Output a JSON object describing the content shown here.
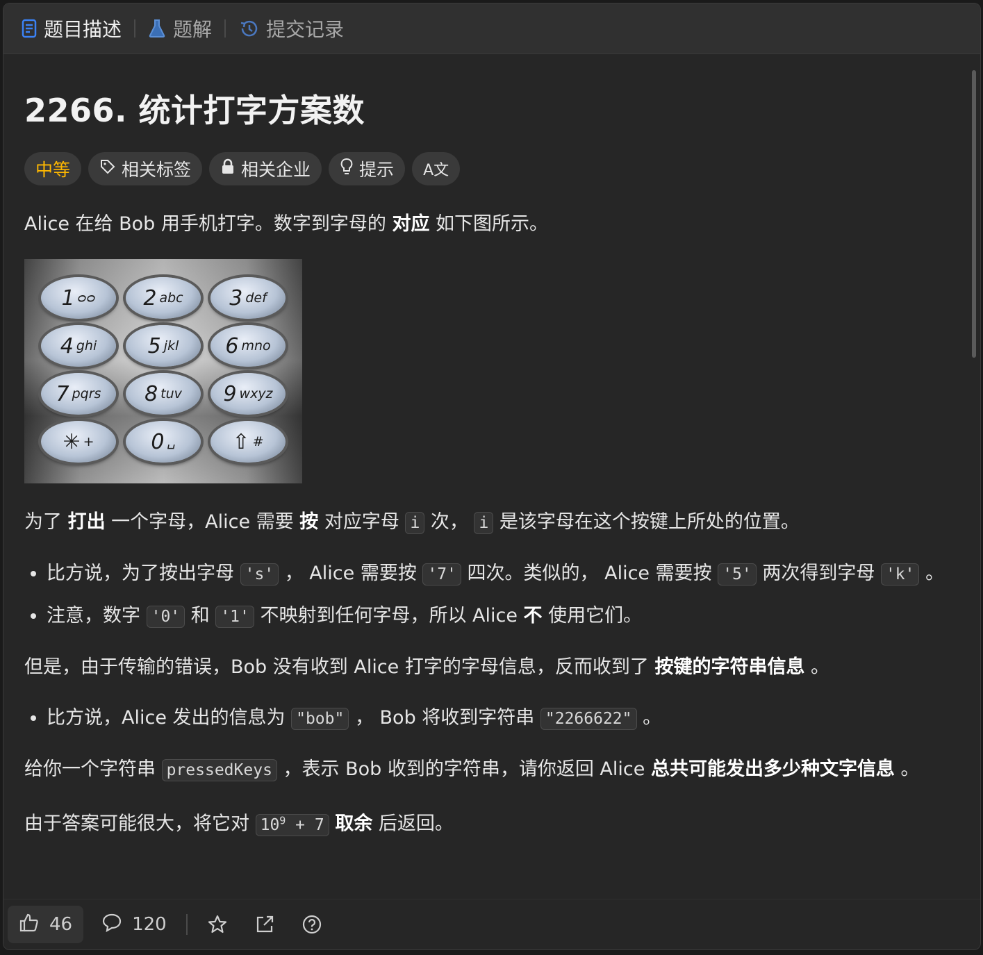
{
  "tabs": [
    {
      "label": "题目描述",
      "icon": "description-icon"
    },
    {
      "label": "题解",
      "icon": "flask-icon"
    },
    {
      "label": "提交记录",
      "icon": "history-icon"
    }
  ],
  "problem": {
    "title": "2266. 统计打字方案数",
    "difficulty": "中等",
    "tags": [
      "相关标签",
      "相关企业",
      "提示"
    ],
    "font_size_toggle": "A文"
  },
  "colors": {
    "difficulty": "#ffb800",
    "background": "#262626"
  },
  "keypad": [
    {
      "digit": "1",
      "letters": "ᴑᴑ"
    },
    {
      "digit": "2",
      "letters": "abc"
    },
    {
      "digit": "3",
      "letters": "def"
    },
    {
      "digit": "4",
      "letters": "ghi"
    },
    {
      "digit": "5",
      "letters": "jkl"
    },
    {
      "digit": "6",
      "letters": "mno"
    },
    {
      "digit": "7",
      "letters": "pqrs"
    },
    {
      "digit": "8",
      "letters": "tuv"
    },
    {
      "digit": "9",
      "letters": "wxyz"
    },
    {
      "digit": "✳",
      "letters": "+"
    },
    {
      "digit": "0",
      "letters": "␣"
    },
    {
      "digit": "⇧",
      "letters": "#"
    }
  ],
  "text": {
    "p1_a": "Alice 在给 Bob 用手机打字。数字到字母的 ",
    "p1_b": "对应",
    "p1_c": " 如下图所示。",
    "p2_a": "为了 ",
    "p2_b": "打出",
    "p2_c": " 一个字母，Alice 需要 ",
    "p2_d": "按",
    "p2_e": " 对应字母 ",
    "p2_code1": "i",
    "p2_f": " 次， ",
    "p2_code2": "i",
    "p2_g": " 是该字母在这个按键上所处的位置。",
    "li1_a": "比方说，为了按出字母 ",
    "li1_code1": "'s'",
    "li1_b": " ， Alice 需要按 ",
    "li1_code2": "'7'",
    "li1_c": " 四次。类似的， Alice 需要按 ",
    "li1_code3": "'5'",
    "li1_d": " 两次得到字母 ",
    "li1_code4": "'k'",
    "li1_e": " 。",
    "li2_a": "注意，数字 ",
    "li2_code1": "'0'",
    "li2_b": " 和 ",
    "li2_code2": "'1'",
    "li2_c": " 不映射到任何字母，所以 Alice ",
    "li2_d": "不",
    "li2_e": " 使用它们。",
    "p3_a": "但是，由于传输的错误，Bob 没有收到 Alice 打字的字母信息，反而收到了 ",
    "p3_b": "按键的字符串信息",
    "p3_c": " 。",
    "li3_a": "比方说，Alice 发出的信息为 ",
    "li3_code1": "\"bob\"",
    "li3_b": " ， Bob 将收到字符串 ",
    "li3_code2": "\"2266622\"",
    "li3_c": " 。",
    "p4_a": "给你一个字符串 ",
    "p4_code": "pressedKeys",
    "p4_b": " ，表示 Bob 收到的字符串，请你返回 Alice ",
    "p4_c": "总共可能发出多少种文字信息",
    "p4_d": " 。",
    "p5_a": "由于答案可能很大，将它对 ",
    "p5_code_base": "10",
    "p5_code_sup": "9",
    "p5_code_rest": " + 7",
    "p5_b": " ",
    "p5_c": "取余",
    "p5_d": " 后返回。"
  },
  "footer": {
    "likes": "46",
    "comments": "120"
  }
}
